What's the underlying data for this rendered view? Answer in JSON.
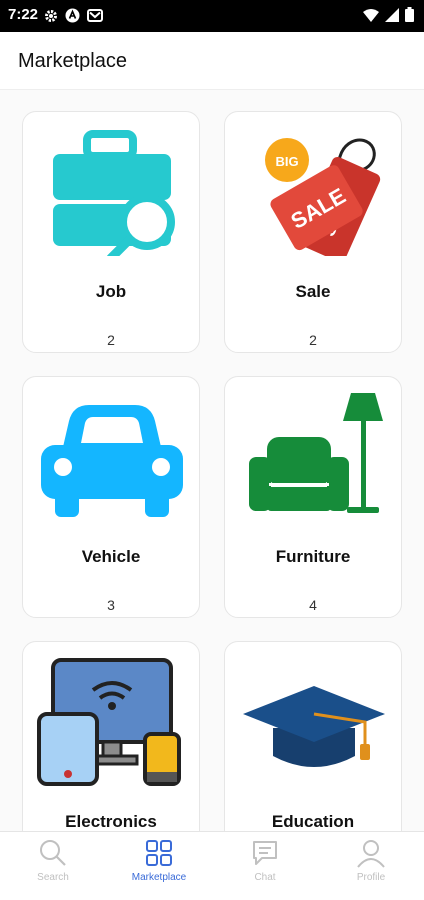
{
  "status_bar": {
    "time": "7:22",
    "icons_left": [
      "gear-icon",
      "android-icon",
      "mail-icon"
    ],
    "icons_right": [
      "wifi-icon",
      "signal-icon",
      "battery-icon"
    ]
  },
  "app_bar": {
    "title": "Marketplace"
  },
  "categories": [
    {
      "label": "Job",
      "count": "2",
      "icon": "briefcase-search-icon"
    },
    {
      "label": "Sale",
      "count": "2",
      "icon": "sale-tag-icon",
      "tag_big": "BIG",
      "tag_sale": "SALE"
    },
    {
      "label": "Vehicle",
      "count": "3",
      "icon": "car-icon"
    },
    {
      "label": "Furniture",
      "count": "4",
      "icon": "armchair-lamp-icon"
    },
    {
      "label": "Electronics",
      "icon": "devices-icon"
    },
    {
      "label": "Education",
      "icon": "graduation-cap-icon"
    }
  ],
  "bottom_nav": {
    "items": [
      {
        "label": "Search",
        "icon": "search-icon"
      },
      {
        "label": "Marketplace",
        "icon": "grid-icon",
        "active": true
      },
      {
        "label": "Chat",
        "icon": "chat-icon"
      },
      {
        "label": "Profile",
        "icon": "profile-icon"
      }
    ]
  },
  "colors": {
    "accent": "#3a6bd8",
    "job": "#26c9cf",
    "sale": "#e2493b",
    "vehicle": "#14b6ff",
    "furniture": "#168c3a",
    "education": "#1a4f8a"
  }
}
